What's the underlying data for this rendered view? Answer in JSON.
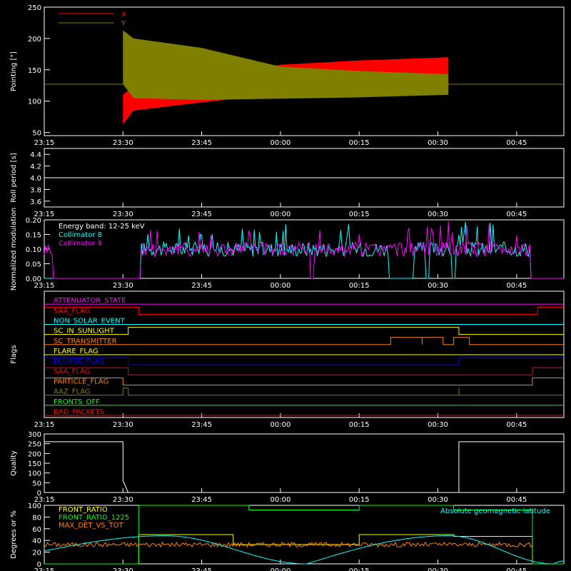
{
  "time_ticks": [
    "23:15",
    "23:30",
    "23:45",
    "00:00",
    "00:15",
    "00:30",
    "00:45"
  ],
  "chart_data": [
    {
      "id": "pointing",
      "type": "area",
      "ylabel": "Pointing [\"]",
      "ylim": [
        45,
        250
      ],
      "yticks": [
        50,
        100,
        150,
        200,
        250
      ],
      "xlim": [
        "23:15",
        "00:54"
      ],
      "legend_position": "top-left",
      "reference_line": 127,
      "series": [
        {
          "name": "X",
          "color": "#ff0000",
          "envelope": [
            {
              "t": "23:30",
              "lo": 63,
              "hi": 110
            },
            {
              "t": "23:32",
              "lo": 85,
              "hi": 125
            },
            {
              "t": "23:45",
              "lo": 98,
              "hi": 142
            },
            {
              "t": "00:00",
              "lo": 112,
              "hi": 158
            },
            {
              "t": "00:15",
              "lo": 117,
              "hi": 165
            },
            {
              "t": "00:32",
              "lo": 120,
              "hi": 170
            }
          ]
        },
        {
          "name": "Y",
          "color": "#808000",
          "envelope": [
            {
              "t": "23:30",
              "lo": 127,
              "hi": 213
            },
            {
              "t": "23:32",
              "lo": 105,
              "hi": 200
            },
            {
              "t": "23:45",
              "lo": 102,
              "hi": 185
            },
            {
              "t": "00:00",
              "lo": 104,
              "hi": 155
            },
            {
              "t": "00:15",
              "lo": 106,
              "hi": 148
            },
            {
              "t": "00:32",
              "lo": 110,
              "hi": 143
            }
          ]
        }
      ]
    },
    {
      "id": "roll",
      "type": "line",
      "ylabel": "Roll period [s]",
      "ylim": [
        3.5,
        4.5
      ],
      "yticks": [
        3.6,
        3.8,
        4.0,
        4.2,
        4.4
      ],
      "series": [
        {
          "name": "",
          "color": "#ffffff",
          "x": [
            "23:15",
            "00:54"
          ],
          "values": [
            4.0,
            4.0
          ]
        }
      ]
    },
    {
      "id": "modulation",
      "type": "line",
      "ylabel": "Normalized modulation",
      "ylim": [
        0,
        0.2
      ],
      "yticks": [
        0.0,
        0.05,
        0.1,
        0.15,
        0.2
      ],
      "annotation": "Energy band: 12-25 keV",
      "series": [
        {
          "name": "Collimator 8",
          "color": "#00ffff",
          "level": 0.1,
          "gaps": [
            [
              "23:15",
              "23:33"
            ],
            [
              "00:21",
              "00:25"
            ],
            [
              "00:28",
              "00:28"
            ],
            [
              "00:33",
              "00:33"
            ],
            [
              "00:48",
              "00:54"
            ]
          ]
        },
        {
          "name": "Collimator 9",
          "color": "#ff00ff",
          "level": 0.1,
          "gaps": [
            [
              "23:17",
              "23:33"
            ],
            [
              "00:06",
              "00:06"
            ],
            [
              "00:48",
              "00:54"
            ]
          ]
        }
      ]
    },
    {
      "id": "flags",
      "type": "line",
      "ylabel": "Flags",
      "series": [
        {
          "name": "ATTENUATOR_STATE",
          "color": "#ff00ff",
          "changes": []
        },
        {
          "name": "SAA_FLAG",
          "color": "#ff0000",
          "changes": [
            {
              "t": "23:33",
              "v": 0
            },
            {
              "t": "00:49",
              "v": 1
            }
          ]
        },
        {
          "name": "NON_SOLAR_EVENT",
          "color": "#00ffff",
          "changes": []
        },
        {
          "name": "SC_IN_SUNLIGHT",
          "color": "#ffff00",
          "changes": [
            {
              "t": "23:31",
              "v": 1
            },
            {
              "t": "00:34",
              "v": 0
            }
          ]
        },
        {
          "name": "SC_TRANSMITTER",
          "color": "#ff8000",
          "changes": [
            {
              "t": "00:21",
              "v": 1
            },
            {
              "t": "00:27",
              "v": 0
            },
            {
              "t": "00:27",
              "v": 1
            },
            {
              "t": "00:31",
              "v": 0
            },
            {
              "t": "00:33",
              "v": 1
            },
            {
              "t": "00:36",
              "v": 0
            }
          ]
        },
        {
          "name": "FLARE_FLAG",
          "color": "#ffff00",
          "changes": []
        },
        {
          "name": "ECLIPSE_FLAG",
          "color": "#0000ff",
          "changes": [
            {
              "t": "23:31",
              "v": 0
            },
            {
              "t": "00:34",
              "v": 1
            }
          ]
        },
        {
          "name": "SAA_FLAG",
          "color": "#ff0000",
          "changes": [
            {
              "t": "23:31",
              "v": 0
            },
            {
              "t": "00:48",
              "v": 1
            }
          ]
        },
        {
          "name": "PARTICLE_FLAG",
          "color": "#ff8000",
          "changes": [
            {
              "t": "23:30",
              "v": 0
            },
            {
              "t": "00:48",
              "v": 1
            }
          ]
        },
        {
          "name": "AAZ_FLAG",
          "color": "#808000",
          "changes": [
            {
              "t": "23:30",
              "v": 1
            },
            {
              "t": "23:31",
              "v": 0
            },
            {
              "t": "00:34",
              "v": 1
            },
            {
              "t": "00:34",
              "v": 0
            }
          ]
        },
        {
          "name": "FRONTS_OFF",
          "color": "#00ff00",
          "changes": []
        },
        {
          "name": "BAD_PACKETS",
          "color": "#ff0000",
          "changes": []
        }
      ]
    },
    {
      "id": "quality",
      "type": "line",
      "ylabel": "Quality",
      "ylim": [
        0,
        300
      ],
      "yticks": [
        0,
        50,
        100,
        150,
        200,
        250,
        300
      ],
      "series": [
        {
          "name": "",
          "color": "#ffffff",
          "x": [
            "23:15",
            "23:30",
            "23:30",
            "23:31",
            "23:31",
            "00:34",
            "00:34",
            "00:54"
          ],
          "values": [
            260,
            260,
            60,
            0,
            0,
            0,
            260,
            260
          ]
        }
      ]
    },
    {
      "id": "degrees",
      "type": "line",
      "ylabel": "Degrees or %",
      "ylim": [
        0,
        100
      ],
      "yticks": [
        0,
        20,
        40,
        60,
        80,
        100
      ],
      "series": [
        {
          "name": "FRONT_RATIO",
          "color": "#ffff00",
          "x": [
            "23:15",
            "23:17",
            "23:17",
            "23:33",
            "23:33",
            "23:51",
            "23:51",
            "00:15",
            "00:15",
            "00:33",
            "00:33",
            "00:48",
            "00:48",
            "00:54"
          ],
          "values": [
            0,
            0,
            0,
            0,
            50,
            50,
            33,
            33,
            50,
            50,
            47,
            47,
            0,
            0
          ]
        },
        {
          "name": "FRONT_RATIO_1225",
          "color": "#00ff00",
          "x": [
            "23:15",
            "23:17",
            "23:17",
            "23:33",
            "23:33",
            "23:54",
            "23:54",
            "00:15",
            "00:15",
            "00:33",
            "00:33",
            "00:48",
            "00:48",
            "00:54"
          ],
          "values": [
            0,
            0,
            0,
            0,
            100,
            100,
            92,
            92,
            100,
            100,
            92,
            92,
            0,
            0
          ]
        },
        {
          "name": "MAX_DET_VS_TOT",
          "color": "#ff8000",
          "x": [
            "23:15",
            "00:48"
          ],
          "values": [
            33,
            33
          ]
        },
        {
          "name": "Absolute geomagnetic latitude",
          "color": "#00ffff",
          "x": [
            "23:15",
            "23:38",
            "00:05",
            "00:32",
            "00:52",
            "00:54"
          ],
          "values": [
            22,
            48,
            0,
            48,
            0,
            5
          ]
        }
      ]
    }
  ]
}
